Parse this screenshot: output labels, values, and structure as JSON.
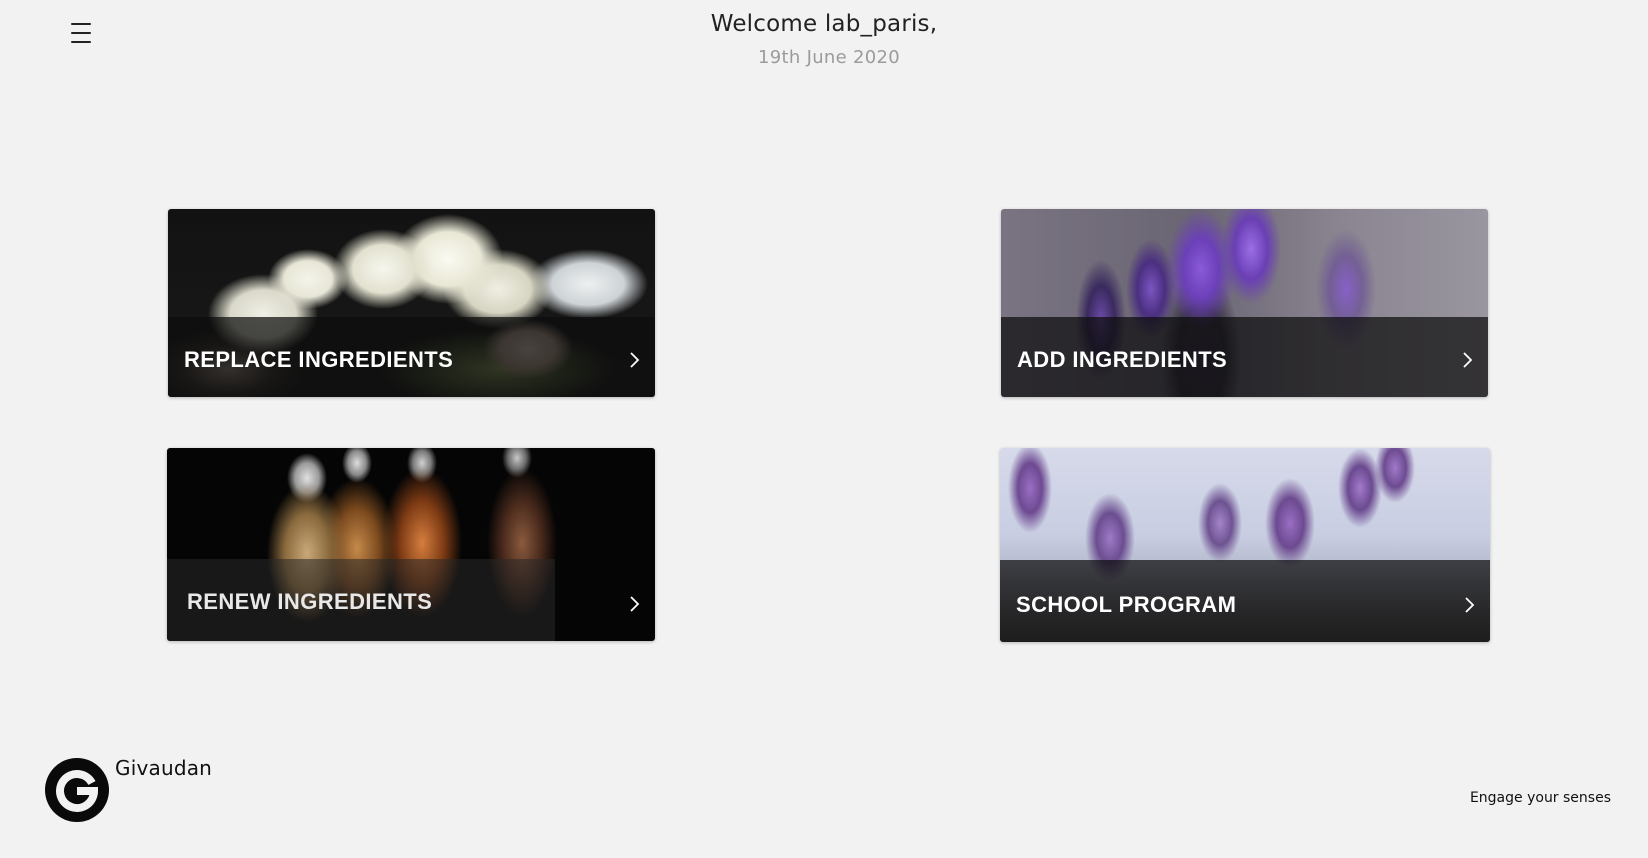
{
  "header": {
    "menu_icon": "hamburger-menu-icon",
    "welcome": "Welcome lab_paris,",
    "date": "19th June 2020"
  },
  "cards": [
    {
      "label": "REPLACE INGREDIENTS",
      "icon": "chevron-right-icon"
    },
    {
      "label": "ADD INGREDIENTS",
      "icon": "chevron-right-icon"
    },
    {
      "label": "RENEW INGREDIENTS",
      "icon": "chevron-right-icon"
    },
    {
      "label": "SCHOOL PROGRAM",
      "icon": "chevron-right-icon"
    }
  ],
  "footer": {
    "brand": "Givaudan",
    "tagline": "Engage your senses"
  },
  "colors": {
    "background": "#f2f2f2",
    "text": "#222222",
    "date": "#9b9b9b",
    "card_bar": "#0c0c0c"
  }
}
